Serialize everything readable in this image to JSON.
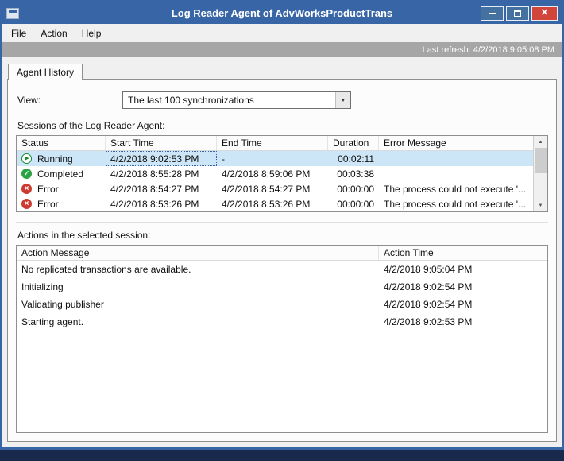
{
  "window": {
    "title": "Log Reader Agent of AdvWorksProductTrans"
  },
  "menu": {
    "items": [
      {
        "label": "File"
      },
      {
        "label": "Action"
      },
      {
        "label": "Help"
      }
    ]
  },
  "refresh_bar": {
    "text": "Last refresh: 4/2/2018 9:05:08 PM"
  },
  "tabs": [
    {
      "label": "Agent History"
    }
  ],
  "view": {
    "label": "View:",
    "value": "The last 100 synchronizations"
  },
  "sessions": {
    "label": "Sessions of the Log Reader Agent:",
    "columns": [
      "Status",
      "Start Time",
      "End Time",
      "Duration",
      "Error Message"
    ],
    "rows": [
      {
        "status": "Running",
        "start": "4/2/2018 9:02:53 PM",
        "end": "-",
        "duration": "00:02:11",
        "error": ""
      },
      {
        "status": "Completed",
        "start": "4/2/2018 8:55:28 PM",
        "end": "4/2/2018 8:59:06 PM",
        "duration": "00:03:38",
        "error": ""
      },
      {
        "status": "Error",
        "start": "4/2/2018 8:54:27 PM",
        "end": "4/2/2018 8:54:27 PM",
        "duration": "00:00:00",
        "error": "The process could not execute '..."
      },
      {
        "status": "Error",
        "start": "4/2/2018 8:53:26 PM",
        "end": "4/2/2018 8:53:26 PM",
        "duration": "00:00:00",
        "error": "The process could not execute '..."
      }
    ]
  },
  "actions": {
    "label": "Actions in the selected session:",
    "columns": [
      "Action Message",
      "Action Time"
    ],
    "rows": [
      {
        "message": "No replicated transactions are available.",
        "time": "4/2/2018 9:05:04 PM"
      },
      {
        "message": "Initializing",
        "time": "4/2/2018 9:02:54 PM"
      },
      {
        "message": "Validating publisher",
        "time": "4/2/2018 9:02:54 PM"
      },
      {
        "message": "Starting agent.",
        "time": "4/2/2018 9:02:53 PM"
      }
    ]
  },
  "icons": {
    "close": "×",
    "combo_arrow": "▼",
    "scroll_up": "▲",
    "scroll_down": "▼",
    "play": "▶",
    "check": "✓",
    "cross": "×"
  },
  "colors": {
    "titlebar_blue": "#3765a6",
    "selection_blue": "#cde6f7",
    "status_running_green": "#178a31",
    "status_completed_green": "#2aa343",
    "status_error_red": "#ce3a31",
    "close_button_red": "#d2453a",
    "refresh_bar_gray": "#a6a6a6"
  }
}
